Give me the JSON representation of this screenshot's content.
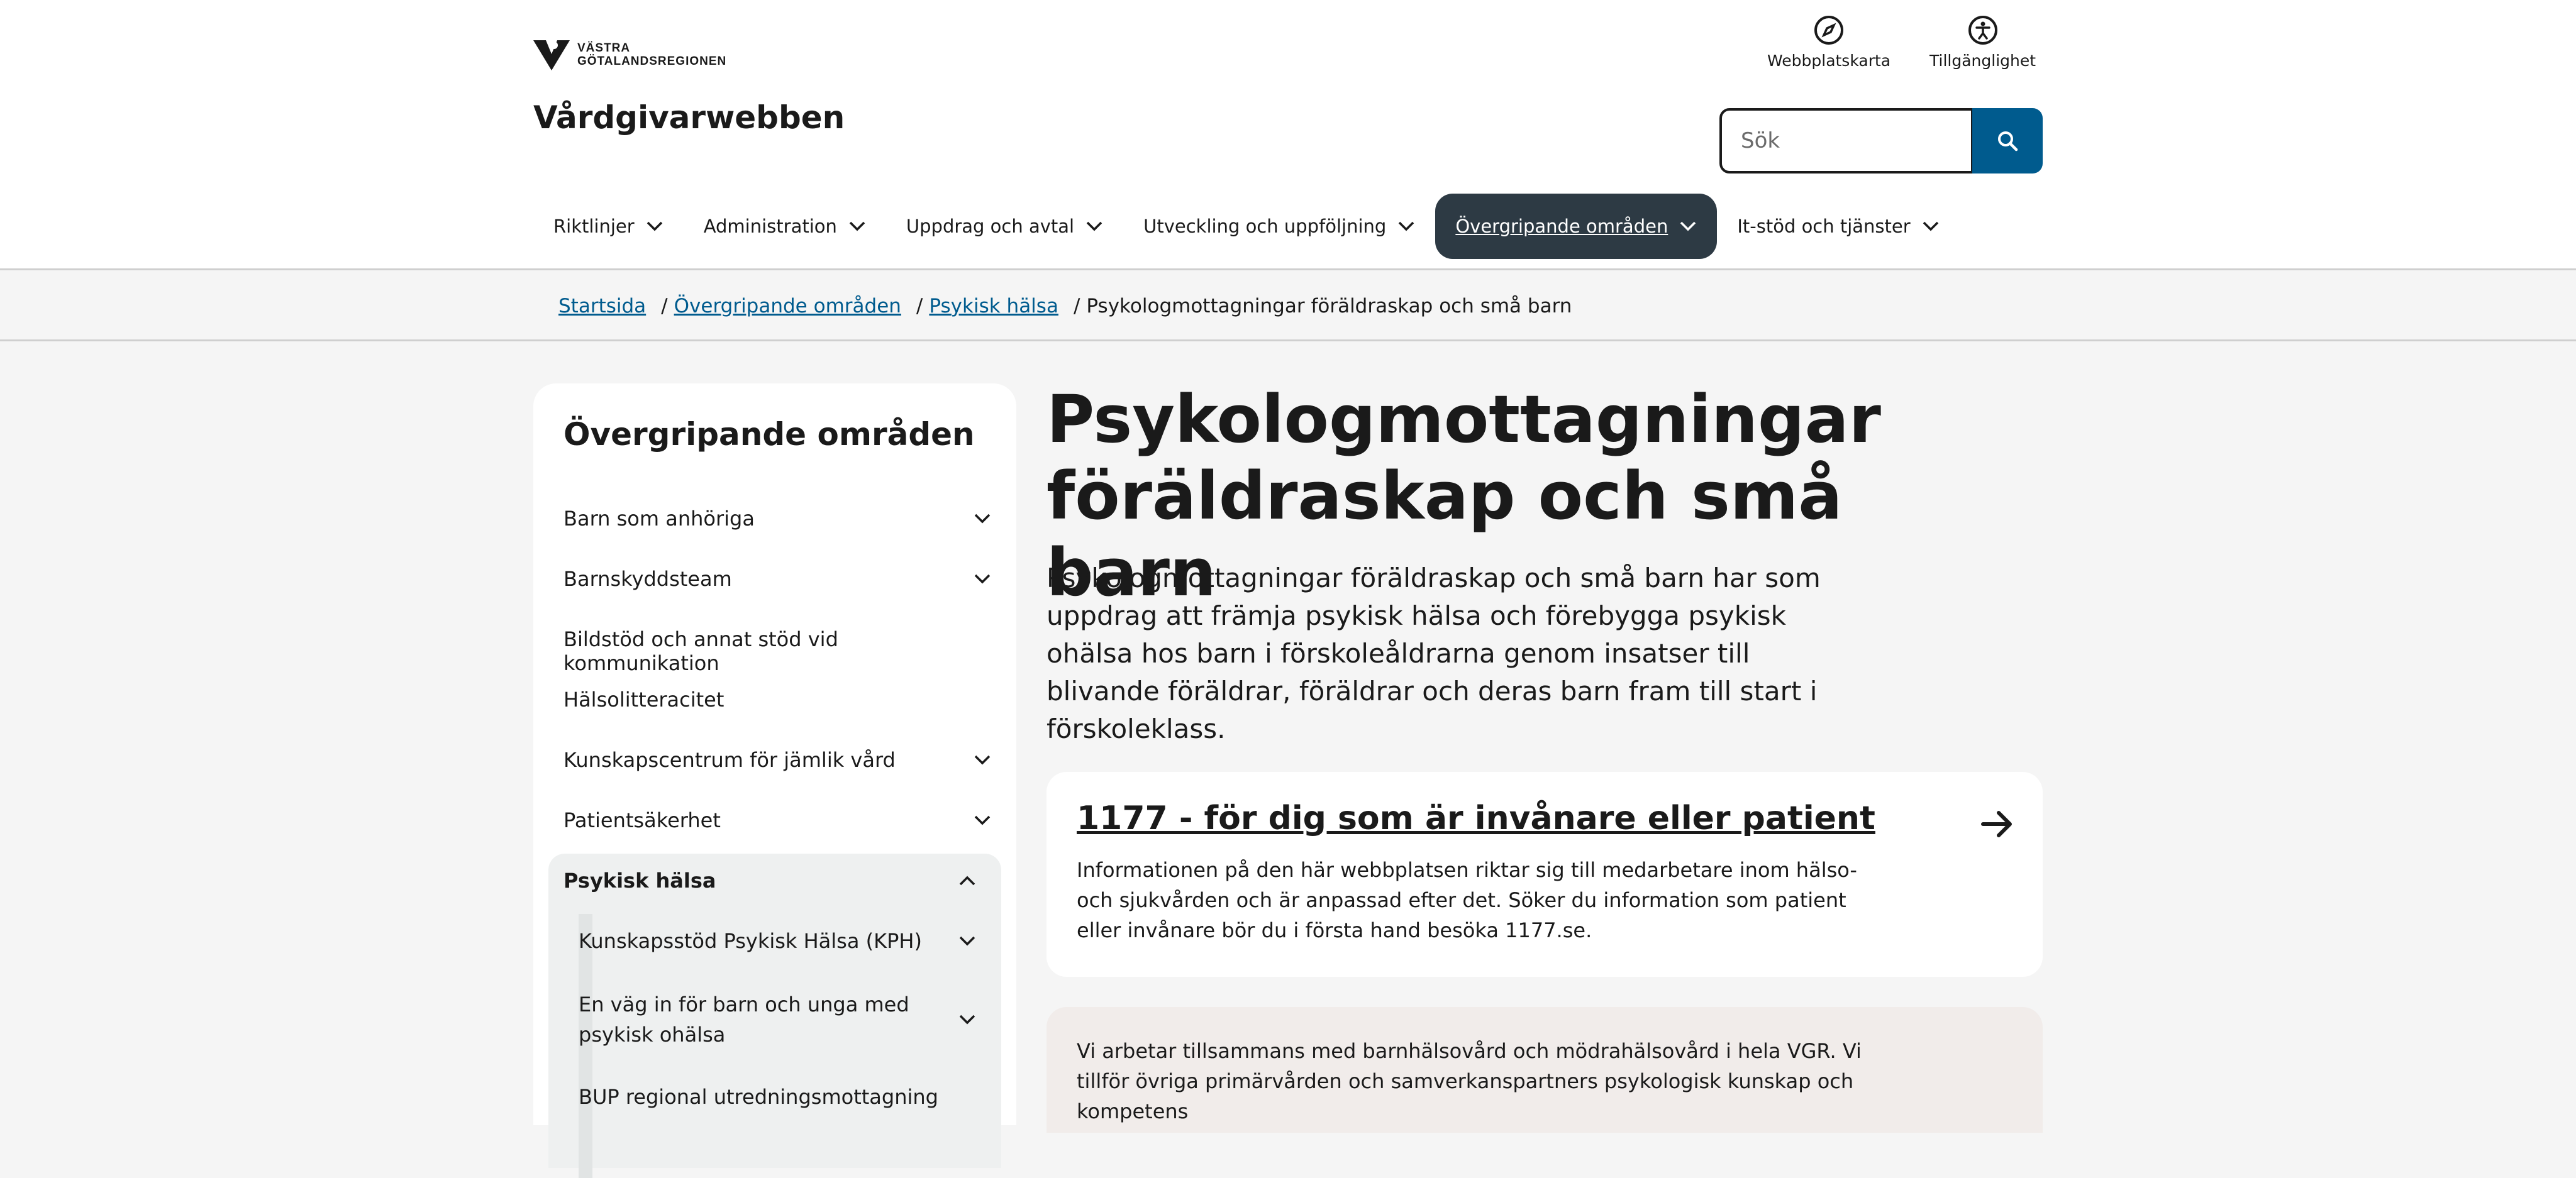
{
  "header": {
    "logo_text_line1": "VÄSTRA",
    "logo_text_line2": "GÖTALANDSREGIONEN",
    "site_title": "Vårdgivarwebben",
    "sitemap_label": "Webbplatskarta",
    "accessibility_label": "Tillgänglighet",
    "search_placeholder": "Sök"
  },
  "nav": {
    "items": [
      {
        "label": "Riktlinjer"
      },
      {
        "label": "Administration"
      },
      {
        "label": "Uppdrag och avtal"
      },
      {
        "label": "Utveckling och uppföljning"
      },
      {
        "label": "Övergripande områden",
        "active": true
      },
      {
        "label": "It-stöd och tjänster"
      }
    ]
  },
  "breadcrumb": {
    "items": [
      "Startsida",
      "Övergripande områden",
      "Psykisk hälsa"
    ],
    "current": "Psykologmottagningar föräldraskap och små barn"
  },
  "sidebar": {
    "title": "Övergripande områden",
    "items": [
      {
        "label": "Barn som anhöriga"
      },
      {
        "label": "Barnskyddsteam"
      },
      {
        "label": "Bildstöd och annat stöd vid kommunikation"
      },
      {
        "label": "Hälsolitteracitet"
      },
      {
        "label": "Kunskapscentrum för jämlik vård"
      },
      {
        "label": "Patientsäkerhet"
      },
      {
        "label": "Psykisk hälsa"
      }
    ],
    "subitems": [
      {
        "label": "Kunskapsstöd Psykisk Hälsa (KPH)"
      },
      {
        "label": "En väg in för barn och unga med psykisk ohälsa"
      },
      {
        "label": "BUP regional utredningsmottagning"
      }
    ]
  },
  "main": {
    "title": "Psykologmottagningar föräldraskap och små barn",
    "lead": "Psykologmottagningar föräldraskap och små barn har som uppdrag att främja psykisk hälsa och förebygga psykisk ohälsa hos barn i förskoleåldrarna genom insatser till blivande föräldrar, föräldrar och deras barn fram till start i förskoleklass.",
    "card_title": "1177 - för dig som är invånare eller patient",
    "card_text": "Informationen på den här webbplatsen riktar sig till medarbetare inom hälso- och sjukvården och är anpassad efter det. Söker du information som patient eller invånare bör du i första hand besöka 1177.se.",
    "info_text": "Vi arbetar tillsammans med barnhälsovård och mödrahälsovård i hela VGR. Vi tillför övriga primärvården och samverkanspartners psykologisk kunskap och kompetens"
  },
  "colors": {
    "brand_blue": "#005b8e",
    "nav_active": "#2d3a44"
  }
}
